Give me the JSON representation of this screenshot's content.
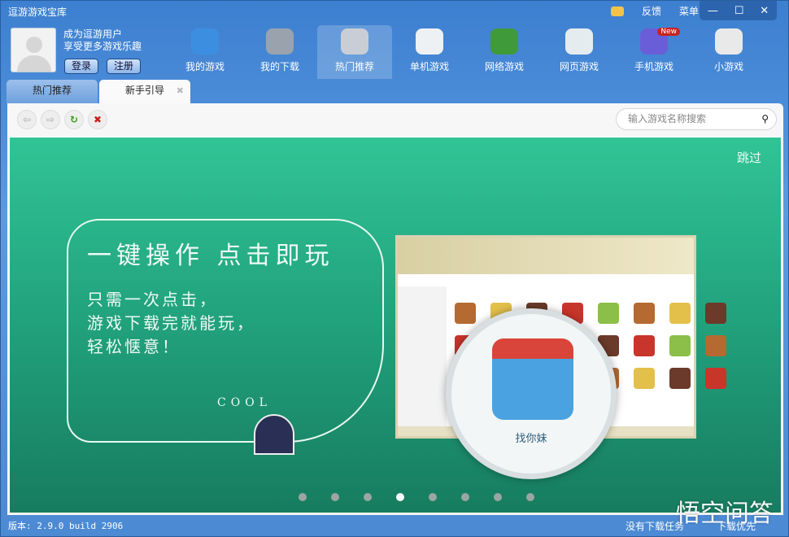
{
  "window": {
    "title": "逗游游戏宝库",
    "feedback": "反馈",
    "menu": "菜单",
    "minimize": "—",
    "maximize": "☐",
    "close": "✕"
  },
  "user": {
    "line1": "成为逗游用户",
    "line2": "享受更多游戏乐趣",
    "login": "登录",
    "register": "注册"
  },
  "nav": [
    {
      "label": "我的游戏",
      "color": "#3c8fe0"
    },
    {
      "label": "我的下载",
      "color": "#9aa3ad"
    },
    {
      "label": "热门推荐",
      "color": "#c9ced6"
    },
    {
      "label": "单机游戏",
      "color": "#eef1f3"
    },
    {
      "label": "网络游戏",
      "color": "#3f9a3a"
    },
    {
      "label": "网页游戏",
      "color": "#e4ecef"
    },
    {
      "label": "手机游戏",
      "color": "#6a5ed8",
      "badge": "New"
    },
    {
      "label": "小游戏",
      "color": "#e9e9e9"
    }
  ],
  "tabs": [
    {
      "label": "热门推荐",
      "active": false
    },
    {
      "label": "新手引导",
      "active": true,
      "close": "✖"
    }
  ],
  "toolbar": {
    "back": "⇦",
    "forward": "⇨",
    "refresh": "↻",
    "stop": "✖",
    "search_placeholder": "输入游戏名称搜索",
    "search_icon": "🔍"
  },
  "banner": {
    "headline": "一键操作 点击即玩",
    "lines": [
      "只需一次点击，",
      "游戏下载完就能玩，",
      "轻松惬意！"
    ],
    "cool": "COOL",
    "skip": "跳过",
    "magnified_game": "找你妹",
    "slides": 8,
    "active_slide": 4
  },
  "status": {
    "version": "版本: 2.9.0 build 2906",
    "no_task": "没有下载任务",
    "priority": "下载优先"
  },
  "watermark": "悟空问答"
}
